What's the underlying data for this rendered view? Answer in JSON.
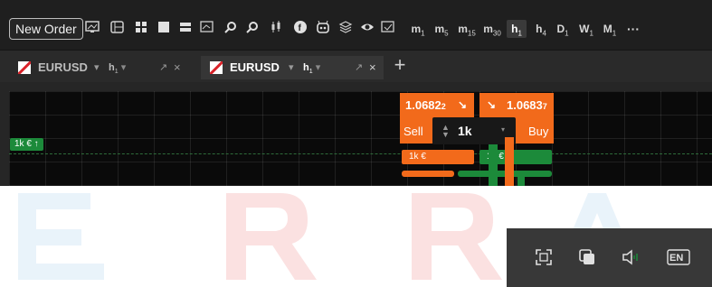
{
  "toolbar": {
    "new_order_label": "New Order",
    "timeframes": [
      {
        "main": "m",
        "sub": "1"
      },
      {
        "main": "m",
        "sub": "5"
      },
      {
        "main": "m",
        "sub": "15"
      },
      {
        "main": "m",
        "sub": "30"
      },
      {
        "main": "h",
        "sub": "1"
      },
      {
        "main": "h",
        "sub": "4"
      },
      {
        "main": "D",
        "sub": "1"
      },
      {
        "main": "W",
        "sub": "1"
      },
      {
        "main": "M",
        "sub": "1"
      }
    ],
    "active_timeframe": "h1",
    "more_label": "···"
  },
  "tabs": [
    {
      "symbol": "EURUSD",
      "dropdown": "▾",
      "timeframe_main": "h",
      "timeframe_sub": "1",
      "close": "×",
      "active": false
    },
    {
      "symbol": "EURUSD",
      "dropdown": "▾",
      "timeframe_main": "h",
      "timeframe_sub": "1",
      "close": "×",
      "active": true
    }
  ],
  "add_tab_label": "+",
  "chart": {
    "position_label": "1k € ↑",
    "sell": {
      "price_main": "1.0682",
      "price_pip": "2",
      "label": "Sell",
      "arrow": "↘"
    },
    "buy": {
      "price_main": "1.0683",
      "price_pip": "7",
      "label": "Buy",
      "arrow": "↘"
    },
    "quantity": {
      "value": "1k",
      "stepper": "▲\n▼",
      "dropdown": "▾"
    },
    "sell_order_tag": "1k €",
    "buy_order_tag": "1k €"
  },
  "tray": {
    "language": "EN"
  },
  "colors": {
    "sell_orange": "#f26a1b",
    "buy_green": "#1c8a3a",
    "toolbar_bg": "#1f1f1f"
  }
}
